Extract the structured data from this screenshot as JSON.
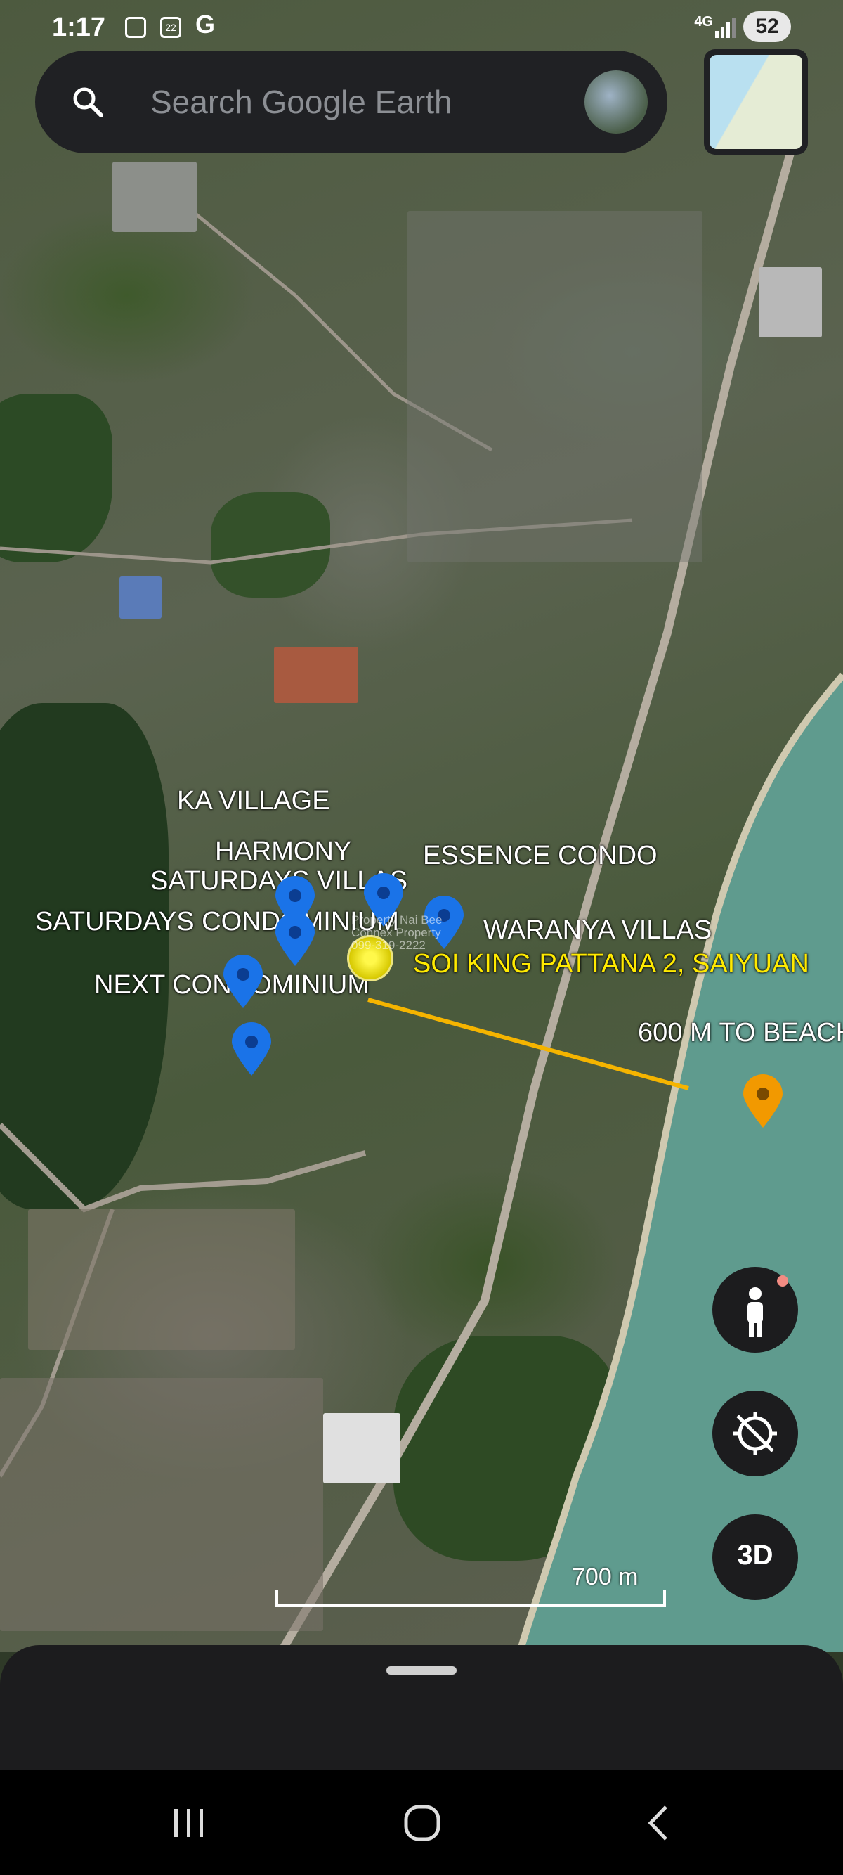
{
  "status_bar": {
    "time": "1:17",
    "icon_badge": "22",
    "network": "4G",
    "battery": "52"
  },
  "search": {
    "placeholder": "Search Google Earth"
  },
  "map_labels": {
    "ka_village": "KA VILLAGE",
    "harmony": "HARMONY",
    "saturdays_villas": "SATURDAYS VILLAS",
    "essence_condo": "ESSENCE CONDO",
    "saturdays_condominium": "SATURDAYS CONDOMINIUM",
    "waranya_villas": "WARANYA VILLAS",
    "soi_king_pattana": "SOI KING PATTANA 2, SAIYUAN",
    "next_condominium": "NEXT CONDOMINIUM",
    "beach_distance": "600 M TO BEACH"
  },
  "watermark": [
    "Property Nai Bee",
    "Connex Property",
    "099-319-2222"
  ],
  "scale": {
    "label": "700 m"
  },
  "controls": {
    "threed_label": "3D"
  },
  "icons": {
    "search": "search-icon",
    "street_view": "pegman-icon",
    "compass": "compass-reset-icon",
    "nav_recent": "recent-apps-icon",
    "nav_home": "home-icon",
    "nav_back": "back-icon"
  },
  "colors": {
    "pin_blue": "#1a73e8",
    "pin_orange": "#f29900",
    "highlight_yellow": "#ffea00",
    "path_line": "#f5b400"
  }
}
